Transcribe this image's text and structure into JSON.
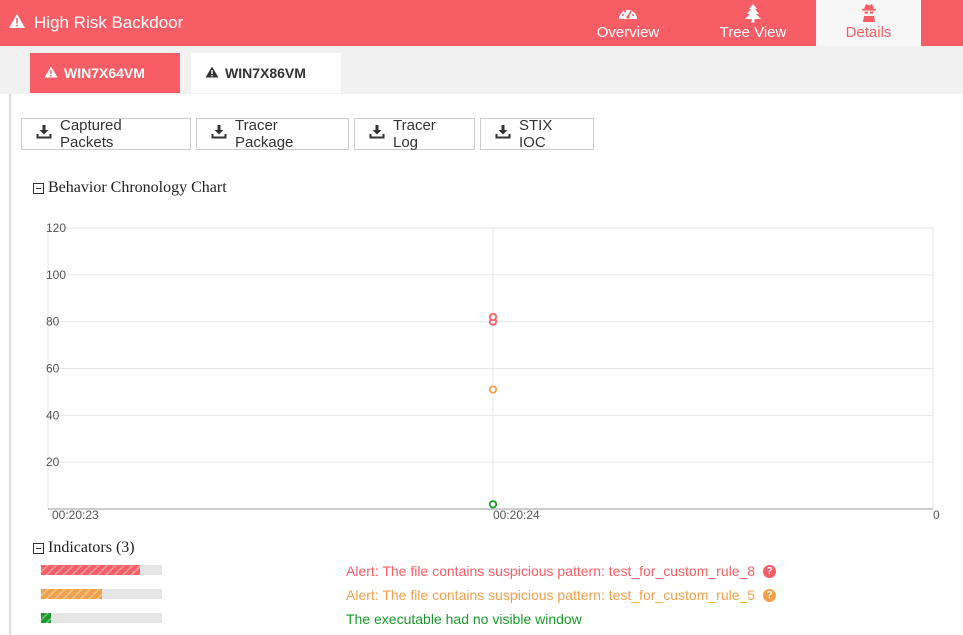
{
  "header": {
    "title": "High Risk Backdoor",
    "nav": [
      {
        "label": "Overview",
        "icon": "dashboard-icon"
      },
      {
        "label": "Tree View",
        "icon": "tree-icon"
      },
      {
        "label": "Details",
        "icon": "spy-icon"
      }
    ],
    "active_nav": "Details"
  },
  "vm_tabs": [
    {
      "label": "WIN7X64VM",
      "icon": "warning-icon"
    },
    {
      "label": "WIN7X86VM",
      "icon": "warning-icon"
    }
  ],
  "downloads": [
    {
      "label": "Captured Packets",
      "icon": "download-icon"
    },
    {
      "label": "Tracer Package",
      "icon": "download-icon"
    },
    {
      "label": "Tracer Log",
      "icon": "download-icon"
    },
    {
      "label": "STIX IOC",
      "icon": "download-icon"
    }
  ],
  "behavior_section": {
    "title": "Behavior Chronology Chart"
  },
  "chart_data": {
    "type": "scatter",
    "title": "",
    "xlabel": "",
    "ylabel": "",
    "x_ticks": [
      "00:20:23",
      "00:20:24",
      "0"
    ],
    "y_ticks": [
      "120",
      "100",
      "80",
      "60",
      "40",
      "20"
    ],
    "ylim": [
      0,
      120
    ],
    "grid": true,
    "series": [
      {
        "color": "#f75d64",
        "points": [
          {
            "x": "00:20:24",
            "y": 80
          },
          {
            "x": "00:20:24",
            "y": 82
          }
        ]
      },
      {
        "color": "#f0a04b",
        "points": [
          {
            "x": "00:20:24",
            "y": 51
          }
        ]
      },
      {
        "color": "#1a9a2a",
        "points": [
          {
            "x": "00:20:24",
            "y": 2
          }
        ]
      }
    ]
  },
  "indicators": {
    "title": "Indicators (3)",
    "items": [
      {
        "text": "Alert: The file contains suspicious pattern: test_for_custom_rule_8",
        "color": "#f75d64",
        "level": 0.82,
        "help": "?"
      },
      {
        "text": "Alert: The file contains suspicious pattern: test_for_custom_rule_5",
        "color": "#f0a04b",
        "level": 0.5,
        "help": "?"
      },
      {
        "text": "The executable had no visible window",
        "color": "#1a9a2a",
        "level": 0.08,
        "help": ""
      }
    ]
  }
}
